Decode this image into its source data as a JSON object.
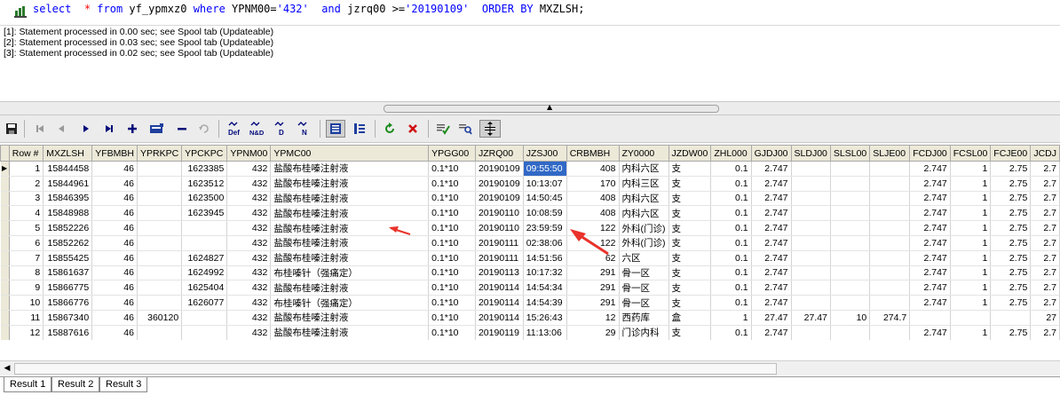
{
  "sql": {
    "select_kw": "select",
    "star": "*",
    "from_kw": "from",
    "table": "yf_ypmxz0",
    "where_kw": "where",
    "cond1": "YPNM00=",
    "val1": "'432'",
    "and_kw": "and",
    "cond2": "jzrq00 >=",
    "val2": "'20190109'",
    "order_kw": "ORDER BY",
    "order_col": "MXZLSH;"
  },
  "messages": [
    "[1]: Statement processed in 0.00 sec; see Spool tab (Updateable)",
    "[2]: Statement processed in 0.03 sec; see Spool tab (Updateable)",
    "[3]: Statement processed in 0.02 sec; see Spool tab (Updateable)"
  ],
  "toolbar": {
    "icons": [
      "save-icon",
      "first-record-icon",
      "prior-record-icon",
      "next-record-icon",
      "last-record-icon",
      "insert-record-icon",
      "edit-record-icon",
      "delete-record-icon",
      "cancel-icon",
      "set-default-icon",
      "set-null-and-default-icon",
      "set-to-default-icon",
      "set-to-null-icon",
      "grid-view-icon",
      "form-view-icon",
      "refresh-icon",
      "clear-filter-icon",
      "post-icon",
      "find-icon",
      "auto-fit-icon"
    ],
    "def_label": "Def",
    "nd_label": "N&D",
    "d_label": "D",
    "n_label": "N"
  },
  "grid": {
    "columns": [
      "Row #",
      "MXZLSH",
      "YFBMBH",
      "YPRKPC",
      "YPCKPC",
      "YPNM00",
      "YPMC00",
      "YPGG00",
      "JZRQ00",
      "JZSJ00",
      "CRBMBH",
      "ZY0000",
      "JZDW00",
      "ZHL000",
      "GJDJ00",
      "SLDJ00",
      "SLSL00",
      "SLJE00",
      "FCDJ00",
      "FCSL00",
      "FCJE00",
      "JCDJ"
    ],
    "rows": [
      [
        "1",
        "15844458",
        "46",
        "",
        "1623385",
        "432",
        "盐酸布桂嗪注射液",
        "0.1*10",
        "20190109",
        "09:55:50",
        "408",
        "内科六区",
        "支",
        "0.1",
        "2.747",
        "",
        "",
        "",
        "2.747",
        "1",
        "2.75",
        "2.7"
      ],
      [
        "2",
        "15844961",
        "46",
        "",
        "1623512",
        "432",
        "盐酸布桂嗪注射液",
        "0.1*10",
        "20190109",
        "10:13:07",
        "170",
        "内科三区",
        "支",
        "0.1",
        "2.747",
        "",
        "",
        "",
        "2.747",
        "1",
        "2.75",
        "2.7"
      ],
      [
        "3",
        "15846395",
        "46",
        "",
        "1623500",
        "432",
        "盐酸布桂嗪注射液",
        "0.1*10",
        "20190109",
        "14:50:45",
        "408",
        "内科六区",
        "支",
        "0.1",
        "2.747",
        "",
        "",
        "",
        "2.747",
        "1",
        "2.75",
        "2.7"
      ],
      [
        "4",
        "15848988",
        "46",
        "",
        "1623945",
        "432",
        "盐酸布桂嗪注射液",
        "0.1*10",
        "20190110",
        "10:08:59",
        "408",
        "内科六区",
        "支",
        "0.1",
        "2.747",
        "",
        "",
        "",
        "2.747",
        "1",
        "2.75",
        "2.7"
      ],
      [
        "5",
        "15852226",
        "46",
        "",
        "",
        "432",
        "盐酸布桂嗪注射液",
        "0.1*10",
        "20190110",
        "23:59:59",
        "122",
        "外科(门诊)",
        "支",
        "0.1",
        "2.747",
        "",
        "",
        "",
        "2.747",
        "1",
        "2.75",
        "2.7"
      ],
      [
        "6",
        "15852262",
        "46",
        "",
        "",
        "432",
        "盐酸布桂嗪注射液",
        "0.1*10",
        "20190111",
        "02:38:06",
        "122",
        "外科(门诊)",
        "支",
        "0.1",
        "2.747",
        "",
        "",
        "",
        "2.747",
        "1",
        "2.75",
        "2.7"
      ],
      [
        "7",
        "15855425",
        "46",
        "",
        "1624827",
        "432",
        "盐酸布桂嗪注射液",
        "0.1*10",
        "20190111",
        "14:51:56",
        "62",
        "六区",
        "支",
        "0.1",
        "2.747",
        "",
        "",
        "",
        "2.747",
        "1",
        "2.75",
        "2.7"
      ],
      [
        "8",
        "15861637",
        "46",
        "",
        "1624992",
        "432",
        "布桂嗪针（强痛定）",
        "0.1*10",
        "20190113",
        "10:17:32",
        "291",
        "骨一区",
        "支",
        "0.1",
        "2.747",
        "",
        "",
        "",
        "2.747",
        "1",
        "2.75",
        "2.7"
      ],
      [
        "9",
        "15866775",
        "46",
        "",
        "1625404",
        "432",
        "盐酸布桂嗪注射液",
        "0.1*10",
        "20190114",
        "14:54:34",
        "291",
        "骨一区",
        "支",
        "0.1",
        "2.747",
        "",
        "",
        "",
        "2.747",
        "1",
        "2.75",
        "2.7"
      ],
      [
        "10",
        "15866776",
        "46",
        "",
        "1626077",
        "432",
        "布桂嗪针（强痛定）",
        "0.1*10",
        "20190114",
        "14:54:39",
        "291",
        "骨一区",
        "支",
        "0.1",
        "2.747",
        "",
        "",
        "",
        "2.747",
        "1",
        "2.75",
        "2.7"
      ],
      [
        "11",
        "15867340",
        "46",
        "360120",
        "",
        "432",
        "盐酸布桂嗪注射液",
        "0.1*10",
        "20190114",
        "15:26:43",
        "12",
        "西药库",
        "盒",
        "1",
        "27.47",
        "27.47",
        "10",
        "274.7",
        "",
        "",
        "",
        "27"
      ],
      [
        "12",
        "15887616",
        "46",
        "",
        "",
        "432",
        "盐酸布桂嗪注射液",
        "0.1*10",
        "20190119",
        "11:13:06",
        "29",
        "门诊内科",
        "支",
        "0.1",
        "2.747",
        "",
        "",
        "",
        "2.747",
        "1",
        "2.75",
        "2.7"
      ]
    ],
    "current_row_marker": "▶"
  },
  "tabs": [
    "Result 1",
    "Result 2",
    "Result 3"
  ],
  "colors": {
    "selection": "#3169c6",
    "keyword": "#0000ff",
    "star": "#ff0000",
    "annotation_arrow": "#e8322a"
  }
}
